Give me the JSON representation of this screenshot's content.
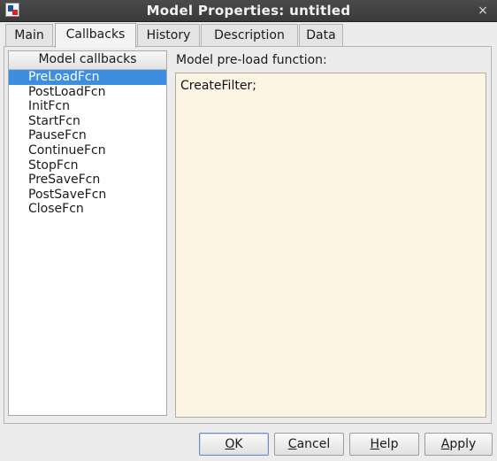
{
  "window": {
    "title": "Model Properties: untitled",
    "close_glyph": "×",
    "app_icon": "simulink-model-icon"
  },
  "tabs": [
    {
      "label": "Main",
      "active": false
    },
    {
      "label": "Callbacks",
      "active": true
    },
    {
      "label": "History",
      "active": false
    },
    {
      "label": "Description",
      "active": false
    },
    {
      "label": "Data",
      "active": false
    }
  ],
  "callbacks": {
    "header": "Model callbacks",
    "selected": "PreLoadFcn",
    "items": [
      "PreLoadFcn",
      "PostLoadFcn",
      "InitFcn",
      "StartFcn",
      "PauseFcn",
      "ContinueFcn",
      "StopFcn",
      "PreSaveFcn",
      "PostSaveFcn",
      "CloseFcn"
    ]
  },
  "editor": {
    "label": "Model pre-load function:",
    "content": "CreateFilter;"
  },
  "buttons": {
    "ok": {
      "mnemonic": "O",
      "rest": "K"
    },
    "cancel": {
      "mnemonic": "C",
      "rest": "ancel"
    },
    "help": {
      "mnemonic": "H",
      "rest": "elp"
    },
    "apply": {
      "mnemonic": "A",
      "rest": "pply"
    }
  },
  "colors": {
    "selection": "#3d8ee0",
    "editor_background": "#fdf5e4",
    "titlebar": "#3a3a3a"
  }
}
